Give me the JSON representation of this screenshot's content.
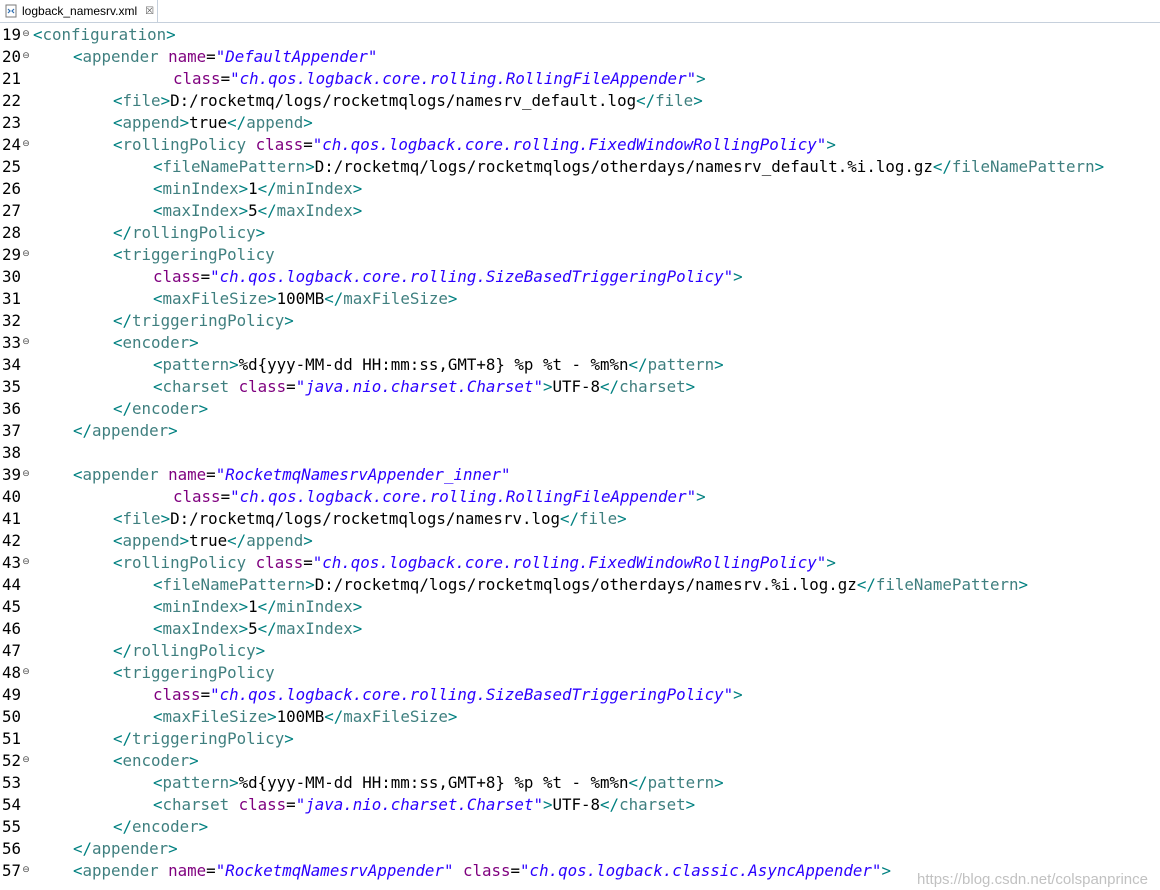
{
  "tab": {
    "label": "logback_namesrv.xml",
    "close": "☒",
    "icon": "xml-file-icon"
  },
  "colors": {
    "bracket": "#008080",
    "tag_name": "#3f7f7f",
    "attr_name": "#7f007f",
    "attr_value": "#2a00ff",
    "text": "#000000"
  },
  "watermark": "https://blog.csdn.net/colspanprince",
  "lines": [
    {
      "n": "19",
      "fold": true,
      "indent": 0,
      "tokens": [
        [
          "b",
          "<"
        ],
        [
          "n",
          "configuration"
        ],
        [
          "b",
          ">"
        ]
      ]
    },
    {
      "n": "20",
      "fold": true,
      "indent": 1,
      "tokens": [
        [
          "b",
          "<"
        ],
        [
          "n",
          "appender"
        ],
        [
          "x",
          " "
        ],
        [
          "a",
          "name"
        ],
        [
          "eq",
          "="
        ],
        [
          "v",
          "\"DefaultAppender\""
        ]
      ]
    },
    {
      "n": "21",
      "fold": false,
      "indent": 3.5,
      "tokens": [
        [
          "a",
          "class"
        ],
        [
          "eq",
          "="
        ],
        [
          "v",
          "\"ch.qos.logback.core.rolling.RollingFileAppender\""
        ],
        [
          "b",
          ">"
        ]
      ]
    },
    {
      "n": "22",
      "fold": false,
      "indent": 2,
      "tokens": [
        [
          "b",
          "<"
        ],
        [
          "n",
          "file"
        ],
        [
          "b",
          ">"
        ],
        [
          "x",
          "D:/rocketmq/logs/rocketmqlogs/namesrv_default.log"
        ],
        [
          "b",
          "</"
        ],
        [
          "n",
          "file"
        ],
        [
          "b",
          ">"
        ]
      ]
    },
    {
      "n": "23",
      "fold": false,
      "indent": 2,
      "tokens": [
        [
          "b",
          "<"
        ],
        [
          "n",
          "append"
        ],
        [
          "b",
          ">"
        ],
        [
          "x",
          "true"
        ],
        [
          "b",
          "</"
        ],
        [
          "n",
          "append"
        ],
        [
          "b",
          ">"
        ]
      ]
    },
    {
      "n": "24",
      "fold": true,
      "indent": 2,
      "tokens": [
        [
          "b",
          "<"
        ],
        [
          "n",
          "rollingPolicy"
        ],
        [
          "x",
          " "
        ],
        [
          "a",
          "class"
        ],
        [
          "eq",
          "="
        ],
        [
          "v",
          "\"ch.qos.logback.core.rolling.FixedWindowRollingPolicy\""
        ],
        [
          "b",
          ">"
        ]
      ]
    },
    {
      "n": "25",
      "fold": false,
      "indent": 3,
      "tokens": [
        [
          "b",
          "<"
        ],
        [
          "n",
          "fileNamePattern"
        ],
        [
          "b",
          ">"
        ],
        [
          "x",
          "D:/rocketmq/logs/rocketmqlogs/otherdays/namesrv_default.%i.log.gz"
        ],
        [
          "b",
          "</"
        ],
        [
          "n",
          "fileNamePattern"
        ],
        [
          "b",
          ">"
        ]
      ]
    },
    {
      "n": "26",
      "fold": false,
      "indent": 3,
      "tokens": [
        [
          "b",
          "<"
        ],
        [
          "n",
          "minIndex"
        ],
        [
          "b",
          ">"
        ],
        [
          "x",
          "1"
        ],
        [
          "b",
          "</"
        ],
        [
          "n",
          "minIndex"
        ],
        [
          "b",
          ">"
        ]
      ]
    },
    {
      "n": "27",
      "fold": false,
      "indent": 3,
      "tokens": [
        [
          "b",
          "<"
        ],
        [
          "n",
          "maxIndex"
        ],
        [
          "b",
          ">"
        ],
        [
          "x",
          "5"
        ],
        [
          "b",
          "</"
        ],
        [
          "n",
          "maxIndex"
        ],
        [
          "b",
          ">"
        ]
      ]
    },
    {
      "n": "28",
      "fold": false,
      "indent": 2,
      "tokens": [
        [
          "b",
          "</"
        ],
        [
          "n",
          "rollingPolicy"
        ],
        [
          "b",
          ">"
        ]
      ]
    },
    {
      "n": "29",
      "fold": true,
      "indent": 2,
      "tokens": [
        [
          "b",
          "<"
        ],
        [
          "n",
          "triggeringPolicy"
        ]
      ]
    },
    {
      "n": "30",
      "fold": false,
      "indent": 3,
      "tokens": [
        [
          "a",
          "class"
        ],
        [
          "eq",
          "="
        ],
        [
          "v",
          "\"ch.qos.logback.core.rolling.SizeBasedTriggeringPolicy\""
        ],
        [
          "b",
          ">"
        ]
      ]
    },
    {
      "n": "31",
      "fold": false,
      "indent": 3,
      "tokens": [
        [
          "b",
          "<"
        ],
        [
          "n",
          "maxFileSize"
        ],
        [
          "b",
          ">"
        ],
        [
          "x",
          "100MB"
        ],
        [
          "b",
          "</"
        ],
        [
          "n",
          "maxFileSize"
        ],
        [
          "b",
          ">"
        ]
      ]
    },
    {
      "n": "32",
      "fold": false,
      "indent": 2,
      "tokens": [
        [
          "b",
          "</"
        ],
        [
          "n",
          "triggeringPolicy"
        ],
        [
          "b",
          ">"
        ]
      ]
    },
    {
      "n": "33",
      "fold": true,
      "indent": 2,
      "tokens": [
        [
          "b",
          "<"
        ],
        [
          "n",
          "encoder"
        ],
        [
          "b",
          ">"
        ]
      ]
    },
    {
      "n": "34",
      "fold": false,
      "indent": 3,
      "tokens": [
        [
          "b",
          "<"
        ],
        [
          "n",
          "pattern"
        ],
        [
          "b",
          ">"
        ],
        [
          "x",
          "%d{yyy-MM-dd HH:mm:ss,GMT+8} %p %t - %m%n"
        ],
        [
          "b",
          "</"
        ],
        [
          "n",
          "pattern"
        ],
        [
          "b",
          ">"
        ]
      ]
    },
    {
      "n": "35",
      "fold": false,
      "indent": 3,
      "tokens": [
        [
          "b",
          "<"
        ],
        [
          "n",
          "charset"
        ],
        [
          "x",
          " "
        ],
        [
          "a",
          "class"
        ],
        [
          "eq",
          "="
        ],
        [
          "v",
          "\"java.nio.charset.Charset\""
        ],
        [
          "b",
          ">"
        ],
        [
          "x",
          "UTF-8"
        ],
        [
          "b",
          "</"
        ],
        [
          "n",
          "charset"
        ],
        [
          "b",
          ">"
        ]
      ]
    },
    {
      "n": "36",
      "fold": false,
      "indent": 2,
      "tokens": [
        [
          "b",
          "</"
        ],
        [
          "n",
          "encoder"
        ],
        [
          "b",
          ">"
        ]
      ]
    },
    {
      "n": "37",
      "fold": false,
      "indent": 1,
      "tokens": [
        [
          "b",
          "</"
        ],
        [
          "n",
          "appender"
        ],
        [
          "b",
          ">"
        ]
      ]
    },
    {
      "n": "38",
      "fold": false,
      "indent": 0,
      "tokens": []
    },
    {
      "n": "39",
      "fold": true,
      "indent": 1,
      "tokens": [
        [
          "b",
          "<"
        ],
        [
          "n",
          "appender"
        ],
        [
          "x",
          " "
        ],
        [
          "a",
          "name"
        ],
        [
          "eq",
          "="
        ],
        [
          "v",
          "\"RocketmqNamesrvAppender_inner\""
        ]
      ]
    },
    {
      "n": "40",
      "fold": false,
      "indent": 3.5,
      "tokens": [
        [
          "a",
          "class"
        ],
        [
          "eq",
          "="
        ],
        [
          "v",
          "\"ch.qos.logback.core.rolling.RollingFileAppender\""
        ],
        [
          "b",
          ">"
        ]
      ]
    },
    {
      "n": "41",
      "fold": false,
      "indent": 2,
      "tokens": [
        [
          "b",
          "<"
        ],
        [
          "n",
          "file"
        ],
        [
          "b",
          ">"
        ],
        [
          "x",
          "D:/rocketmq/logs/rocketmqlogs/namesrv.log"
        ],
        [
          "b",
          "</"
        ],
        [
          "n",
          "file"
        ],
        [
          "b",
          ">"
        ]
      ]
    },
    {
      "n": "42",
      "fold": false,
      "indent": 2,
      "tokens": [
        [
          "b",
          "<"
        ],
        [
          "n",
          "append"
        ],
        [
          "b",
          ">"
        ],
        [
          "x",
          "true"
        ],
        [
          "b",
          "</"
        ],
        [
          "n",
          "append"
        ],
        [
          "b",
          ">"
        ]
      ]
    },
    {
      "n": "43",
      "fold": true,
      "indent": 2,
      "tokens": [
        [
          "b",
          "<"
        ],
        [
          "n",
          "rollingPolicy"
        ],
        [
          "x",
          " "
        ],
        [
          "a",
          "class"
        ],
        [
          "eq",
          "="
        ],
        [
          "v",
          "\"ch.qos.logback.core.rolling.FixedWindowRollingPolicy\""
        ],
        [
          "b",
          ">"
        ]
      ]
    },
    {
      "n": "44",
      "fold": false,
      "indent": 3,
      "tokens": [
        [
          "b",
          "<"
        ],
        [
          "n",
          "fileNamePattern"
        ],
        [
          "b",
          ">"
        ],
        [
          "x",
          "D:/rocketmq/logs/rocketmqlogs/otherdays/namesrv.%i.log.gz"
        ],
        [
          "b",
          "</"
        ],
        [
          "n",
          "fileNamePattern"
        ],
        [
          "b",
          ">"
        ]
      ]
    },
    {
      "n": "45",
      "fold": false,
      "indent": 3,
      "tokens": [
        [
          "b",
          "<"
        ],
        [
          "n",
          "minIndex"
        ],
        [
          "b",
          ">"
        ],
        [
          "x",
          "1"
        ],
        [
          "b",
          "</"
        ],
        [
          "n",
          "minIndex"
        ],
        [
          "b",
          ">"
        ]
      ]
    },
    {
      "n": "46",
      "fold": false,
      "indent": 3,
      "tokens": [
        [
          "b",
          "<"
        ],
        [
          "n",
          "maxIndex"
        ],
        [
          "b",
          ">"
        ],
        [
          "x",
          "5"
        ],
        [
          "b",
          "</"
        ],
        [
          "n",
          "maxIndex"
        ],
        [
          "b",
          ">"
        ]
      ]
    },
    {
      "n": "47",
      "fold": false,
      "indent": 2,
      "tokens": [
        [
          "b",
          "</"
        ],
        [
          "n",
          "rollingPolicy"
        ],
        [
          "b",
          ">"
        ]
      ]
    },
    {
      "n": "48",
      "fold": true,
      "indent": 2,
      "tokens": [
        [
          "b",
          "<"
        ],
        [
          "n",
          "triggeringPolicy"
        ]
      ]
    },
    {
      "n": "49",
      "fold": false,
      "indent": 3,
      "tokens": [
        [
          "a",
          "class"
        ],
        [
          "eq",
          "="
        ],
        [
          "v",
          "\"ch.qos.logback.core.rolling.SizeBasedTriggeringPolicy\""
        ],
        [
          "b",
          ">"
        ]
      ]
    },
    {
      "n": "50",
      "fold": false,
      "indent": 3,
      "tokens": [
        [
          "b",
          "<"
        ],
        [
          "n",
          "maxFileSize"
        ],
        [
          "b",
          ">"
        ],
        [
          "x",
          "100MB"
        ],
        [
          "b",
          "</"
        ],
        [
          "n",
          "maxFileSize"
        ],
        [
          "b",
          ">"
        ]
      ]
    },
    {
      "n": "51",
      "fold": false,
      "indent": 2,
      "tokens": [
        [
          "b",
          "</"
        ],
        [
          "n",
          "triggeringPolicy"
        ],
        [
          "b",
          ">"
        ]
      ]
    },
    {
      "n": "52",
      "fold": true,
      "indent": 2,
      "tokens": [
        [
          "b",
          "<"
        ],
        [
          "n",
          "encoder"
        ],
        [
          "b",
          ">"
        ]
      ]
    },
    {
      "n": "53",
      "fold": false,
      "indent": 3,
      "tokens": [
        [
          "b",
          "<"
        ],
        [
          "n",
          "pattern"
        ],
        [
          "b",
          ">"
        ],
        [
          "x",
          "%d{yyy-MM-dd HH:mm:ss,GMT+8} %p %t - %m%n"
        ],
        [
          "b",
          "</"
        ],
        [
          "n",
          "pattern"
        ],
        [
          "b",
          ">"
        ]
      ]
    },
    {
      "n": "54",
      "fold": false,
      "indent": 3,
      "tokens": [
        [
          "b",
          "<"
        ],
        [
          "n",
          "charset"
        ],
        [
          "x",
          " "
        ],
        [
          "a",
          "class"
        ],
        [
          "eq",
          "="
        ],
        [
          "v",
          "\"java.nio.charset.Charset\""
        ],
        [
          "b",
          ">"
        ],
        [
          "x",
          "UTF-8"
        ],
        [
          "b",
          "</"
        ],
        [
          "n",
          "charset"
        ],
        [
          "b",
          ">"
        ]
      ]
    },
    {
      "n": "55",
      "fold": false,
      "indent": 2,
      "tokens": [
        [
          "b",
          "</"
        ],
        [
          "n",
          "encoder"
        ],
        [
          "b",
          ">"
        ]
      ]
    },
    {
      "n": "56",
      "fold": false,
      "indent": 1,
      "tokens": [
        [
          "b",
          "</"
        ],
        [
          "n",
          "appender"
        ],
        [
          "b",
          ">"
        ]
      ]
    },
    {
      "n": "57",
      "fold": true,
      "indent": 1,
      "tokens": [
        [
          "b",
          "<"
        ],
        [
          "n",
          "appender"
        ],
        [
          "x",
          " "
        ],
        [
          "a",
          "name"
        ],
        [
          "eq",
          "="
        ],
        [
          "v",
          "\"RocketmqNamesrvAppender\""
        ],
        [
          "x",
          " "
        ],
        [
          "a",
          "class"
        ],
        [
          "eq",
          "="
        ],
        [
          "v",
          "\"ch.qos.logback.classic.AsyncAppender\""
        ],
        [
          "b",
          ">"
        ]
      ]
    }
  ]
}
